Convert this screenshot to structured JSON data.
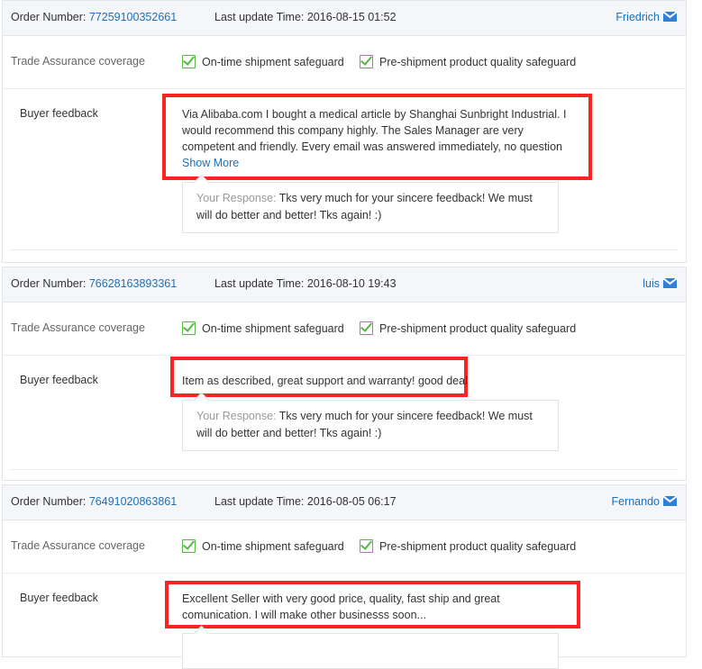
{
  "labels": {
    "order_number": "Order Number:",
    "last_update": "Last update Time:",
    "trade_assurance": "Trade Assurance coverage",
    "safeguard_1": "On-time shipment safeguard",
    "safeguard_2": "Pre-shipment product quality safeguard",
    "buyer_feedback": "Buyer feedback",
    "your_response": "Your Response:",
    "show_more": "Show More"
  },
  "orders": [
    {
      "order_number": "77259100352661",
      "last_update": "2016-08-15 01:52",
      "buyer": "Friedrich",
      "feedback": "Via Alibaba.com I bought a medical article by Shanghai Sunbright Industrial. I would recommend this company highly. The Sales Manager are very competent and friendly. Every email was answered immediately, no question",
      "response": "Tks very much for your sincere feedback! We must will do better and better! Tks again! :)"
    },
    {
      "order_number": "76628163893361",
      "last_update": "2016-08-10 19:43",
      "buyer": "luis",
      "feedback": "Item as described, great support and warranty! good deal",
      "response": "Tks very much for your sincere feedback! We must will do better and better! Tks again! :)"
    },
    {
      "order_number": "76491020863861",
      "last_update": "2016-08-05 06:17",
      "buyer": "Fernando",
      "feedback": "Excellent Seller with very good price, quality, fast ship and great comunication. I will make other businesss soon...",
      "response": ""
    }
  ],
  "colors": {
    "link": "#1d6fb8",
    "highlight": "#ff2222",
    "check": "#57b847"
  }
}
